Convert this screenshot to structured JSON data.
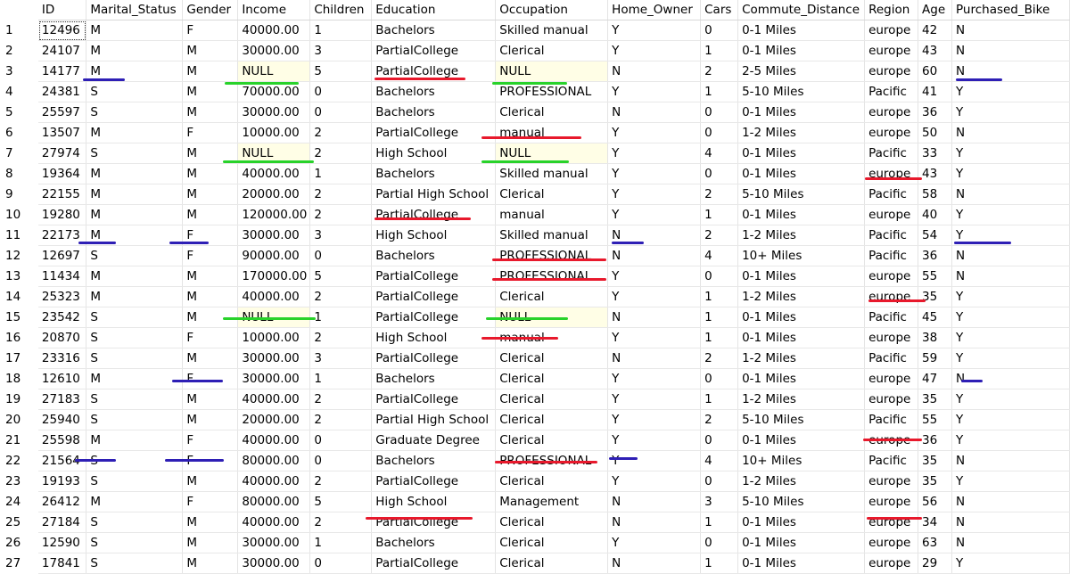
{
  "columns": [
    "",
    "ID",
    "Marital_Status",
    "Gender",
    "Income",
    "Children",
    "Education",
    "Occupation",
    "Home_Owner",
    "Cars",
    "Commute_Distance",
    "Region",
    "Age",
    "Purchased_Bike"
  ],
  "rows": [
    [
      "1",
      "12496",
      "M",
      "F",
      "40000.00",
      "1",
      "Bachelors",
      "Skilled manual",
      "Y",
      "0",
      "0-1 Miles",
      "europe",
      "42",
      "N"
    ],
    [
      "2",
      "24107",
      "M",
      "M",
      "30000.00",
      "3",
      "PartialCollege",
      "Clerical",
      "Y",
      "1",
      "0-1 Miles",
      "europe",
      "43",
      "N"
    ],
    [
      "3",
      "14177",
      "M",
      "M",
      "NULL",
      "5",
      "PartialCollege",
      "NULL",
      "N",
      "2",
      "2-5 Miles",
      "europe",
      "60",
      "N"
    ],
    [
      "4",
      "24381",
      "S",
      "M",
      "70000.00",
      "0",
      "Bachelors",
      "PROFESSIONAL",
      "Y",
      "1",
      "5-10 Miles",
      "Pacific",
      "41",
      "Y"
    ],
    [
      "5",
      "25597",
      "S",
      "M",
      "30000.00",
      "0",
      "Bachelors",
      "Clerical",
      "N",
      "0",
      "0-1 Miles",
      "europe",
      "36",
      "Y"
    ],
    [
      "6",
      "13507",
      "M",
      "F",
      "10000.00",
      "2",
      "PartialCollege",
      "manual",
      "Y",
      "0",
      "1-2 Miles",
      "europe",
      "50",
      "N"
    ],
    [
      "7",
      "27974",
      "S",
      "M",
      "NULL",
      "2",
      "High School",
      "NULL",
      "Y",
      "4",
      "0-1 Miles",
      "Pacific",
      "33",
      "Y"
    ],
    [
      "8",
      "19364",
      "M",
      "M",
      "40000.00",
      "1",
      "Bachelors",
      "Skilled manual",
      "Y",
      "0",
      "0-1 Miles",
      "europe",
      "43",
      "Y"
    ],
    [
      "9",
      "22155",
      "M",
      "M",
      "20000.00",
      "2",
      "Partial High School",
      "Clerical",
      "Y",
      "2",
      "5-10 Miles",
      "Pacific",
      "58",
      "N"
    ],
    [
      "10",
      "19280",
      "M",
      "M",
      "120000.00",
      "2",
      "PartialCollege",
      "manual",
      "Y",
      "1",
      "0-1 Miles",
      "europe",
      "40",
      "Y"
    ],
    [
      "11",
      "22173",
      "M",
      "F",
      "30000.00",
      "3",
      "High School",
      "Skilled manual",
      "N",
      "2",
      "1-2 Miles",
      "Pacific",
      "54",
      "Y"
    ],
    [
      "12",
      "12697",
      "S",
      "F",
      "90000.00",
      "0",
      "Bachelors",
      "PROFESSIONAL",
      "N",
      "4",
      "10+ Miles",
      "Pacific",
      "36",
      "N"
    ],
    [
      "13",
      "11434",
      "M",
      "M",
      "170000.00",
      "5",
      "PartialCollege",
      "PROFESSIONAL",
      "Y",
      "0",
      "0-1 Miles",
      "europe",
      "55",
      "N"
    ],
    [
      "14",
      "25323",
      "M",
      "M",
      "40000.00",
      "2",
      "PartialCollege",
      "Clerical",
      "Y",
      "1",
      "1-2 Miles",
      "europe",
      "35",
      "Y"
    ],
    [
      "15",
      "23542",
      "S",
      "M",
      "NULL",
      "1",
      "PartialCollege",
      "NULL",
      "N",
      "1",
      "0-1 Miles",
      "Pacific",
      "45",
      "Y"
    ],
    [
      "16",
      "20870",
      "S",
      "F",
      "10000.00",
      "2",
      "High School",
      "manual",
      "Y",
      "1",
      "0-1 Miles",
      "europe",
      "38",
      "Y"
    ],
    [
      "17",
      "23316",
      "S",
      "M",
      "30000.00",
      "3",
      "PartialCollege",
      "Clerical",
      "N",
      "2",
      "1-2 Miles",
      "Pacific",
      "59",
      "Y"
    ],
    [
      "18",
      "12610",
      "M",
      "F",
      "30000.00",
      "1",
      "Bachelors",
      "Clerical",
      "Y",
      "0",
      "0-1 Miles",
      "europe",
      "47",
      "N"
    ],
    [
      "19",
      "27183",
      "S",
      "M",
      "40000.00",
      "2",
      "PartialCollege",
      "Clerical",
      "Y",
      "1",
      "1-2 Miles",
      "europe",
      "35",
      "Y"
    ],
    [
      "20",
      "25940",
      "S",
      "M",
      "20000.00",
      "2",
      "Partial High School",
      "Clerical",
      "Y",
      "2",
      "5-10 Miles",
      "Pacific",
      "55",
      "Y"
    ],
    [
      "21",
      "25598",
      "M",
      "F",
      "40000.00",
      "0",
      "Graduate Degree",
      "Clerical",
      "Y",
      "0",
      "0-1 Miles",
      "europe",
      "36",
      "Y"
    ],
    [
      "22",
      "21564",
      "S",
      "F",
      "80000.00",
      "0",
      "Bachelors",
      "PROFESSIONAL",
      "Y",
      "4",
      "10+ Miles",
      "Pacific",
      "35",
      "N"
    ],
    [
      "23",
      "19193",
      "S",
      "M",
      "40000.00",
      "2",
      "PartialCollege",
      "Clerical",
      "Y",
      "0",
      "1-2 Miles",
      "europe",
      "35",
      "Y"
    ],
    [
      "24",
      "26412",
      "M",
      "F",
      "80000.00",
      "5",
      "High School",
      "Management",
      "N",
      "3",
      "5-10 Miles",
      "europe",
      "56",
      "N"
    ],
    [
      "25",
      "27184",
      "S",
      "M",
      "40000.00",
      "2",
      "PartialCollege",
      "Clerical",
      "N",
      "1",
      "0-1 Miles",
      "europe",
      "34",
      "N"
    ],
    [
      "26",
      "12590",
      "S",
      "M",
      "30000.00",
      "1",
      "Bachelors",
      "Clerical",
      "Y",
      "0",
      "0-1 Miles",
      "europe",
      "63",
      "N"
    ],
    [
      "27",
      "17841",
      "S",
      "M",
      "30000.00",
      "0",
      "PartialCollege",
      "Clerical",
      "N",
      "1",
      "0-1 Miles",
      "europe",
      "29",
      "Y"
    ]
  ],
  "colors": {
    "null_cell_bg": "#fffee6",
    "annotation_red": "#e8192c",
    "annotation_green": "#28d22a",
    "annotation_blue": "#2e1fb5"
  }
}
